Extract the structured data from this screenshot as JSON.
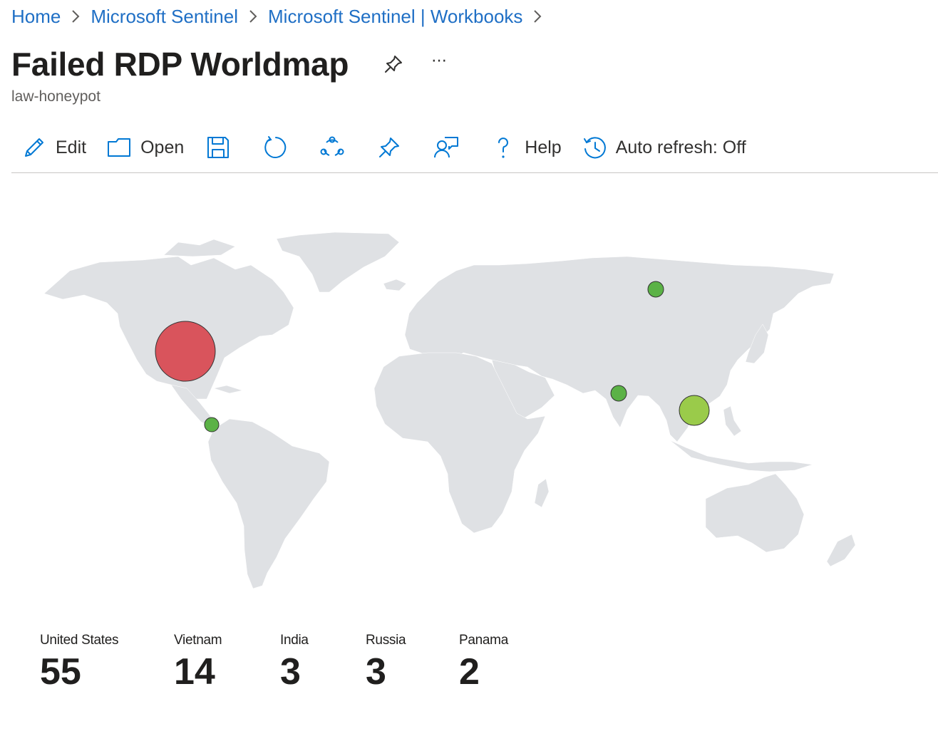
{
  "breadcrumb": [
    "Home",
    "Microsoft Sentinel",
    "Microsoft Sentinel | Workbooks"
  ],
  "page": {
    "title": "Failed RDP Worldmap",
    "subtitle": "law-honeypot",
    "more_label": "⋯"
  },
  "toolbar": {
    "edit_label": "Edit",
    "open_label": "Open",
    "help_label": "Help",
    "auto_refresh_label": "Auto refresh: Off"
  },
  "colors": {
    "link": "#1f6fc5",
    "icon": "#0078d4",
    "land": "#dfe1e4",
    "bubble_high": "#d9545c",
    "bubble_mid": "#9acb4a",
    "bubble_low": "#5bb246"
  },
  "map": {
    "locations": [
      {
        "country": "United States",
        "count": 55,
        "color": "#d9545c"
      },
      {
        "country": "Vietnam",
        "count": 14,
        "color": "#9acb4a"
      },
      {
        "country": "India",
        "count": 3,
        "color": "#5bb246"
      },
      {
        "country": "Russia",
        "count": 3,
        "color": "#5bb246"
      },
      {
        "country": "Panama",
        "count": 2,
        "color": "#5bb246"
      }
    ]
  },
  "tiles": [
    {
      "label": "United States",
      "value": "55"
    },
    {
      "label": "Vietnam",
      "value": "14"
    },
    {
      "label": "India",
      "value": "3"
    },
    {
      "label": "Russia",
      "value": "3"
    },
    {
      "label": "Panama",
      "value": "2"
    }
  ]
}
